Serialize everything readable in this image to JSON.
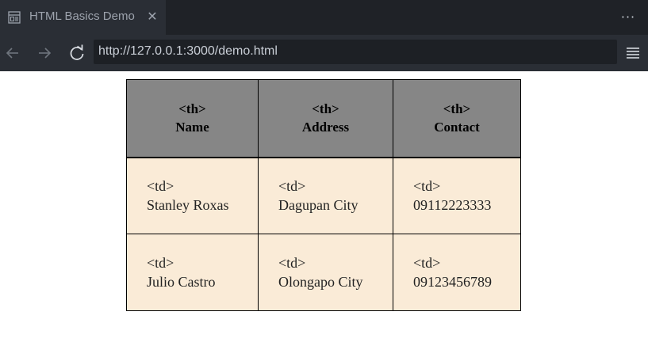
{
  "tab": {
    "title": "HTML Basics Demo",
    "icon": "page-icon",
    "close_glyph": "✕"
  },
  "toolbar": {
    "more_glyph": "···",
    "back_icon": "back-arrow-icon",
    "forward_icon": "forward-arrow-icon",
    "reload_icon": "reload-icon",
    "menu_icon": "hamburger-menu-icon"
  },
  "address": {
    "url": "http://127.0.0.1:3000/demo.html"
  },
  "table": {
    "header_tag": "<th>",
    "cell_tag": "<td>",
    "headers": [
      "Name",
      "Address",
      "Contact"
    ],
    "rows": [
      [
        "Stanley Roxas",
        "Dagupan City",
        "09112223333"
      ],
      [
        "Julio Castro",
        "Olongapo City",
        "09123456789"
      ]
    ],
    "header_bg": "#868686",
    "cell_bg": "#faebd7"
  },
  "colors": {
    "tabbar_bg": "#1f2227",
    "toolbar_bg": "#2a2e35",
    "address_bg": "#1d2025"
  }
}
